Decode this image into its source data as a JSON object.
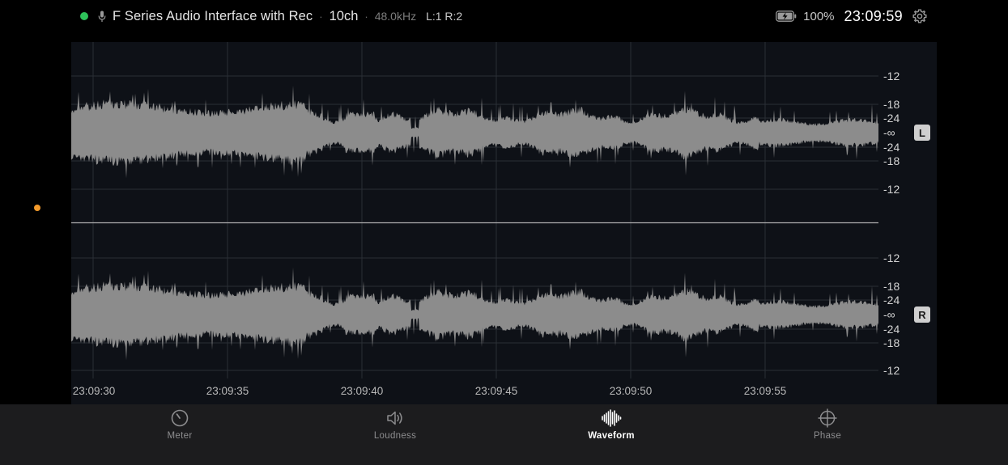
{
  "status_bar": {
    "connection_status_color": "#2ec25a",
    "device_name": "F Series Audio Interface with Rec",
    "separator": "·",
    "channels": "10ch",
    "sample_rate": "48.0kHz",
    "channel_map": "L:1 R:2",
    "battery_percent": "100%",
    "clock": "23:09:59",
    "icons": {
      "mic": "microphone-icon",
      "battery": "battery-charging-icon",
      "settings": "gear-icon"
    }
  },
  "waveform": {
    "channels": [
      {
        "badge": "L",
        "db_labels": [
          "-12",
          "-18",
          "-24",
          "-∞",
          "-24",
          "-18",
          "-12"
        ]
      },
      {
        "badge": "R",
        "db_labels": [
          "-12",
          "-18",
          "-24",
          "-∞",
          "-24",
          "-18",
          "-12"
        ]
      }
    ],
    "time_labels": [
      "23:09:30",
      "23:09:35",
      "23:09:40",
      "23:09:45",
      "23:09:50",
      "23:09:55"
    ],
    "colors": {
      "background": "#0e1117",
      "waveform": "#8c8c8c",
      "gridline": "#2a2e36",
      "center_line": "#b0b0b0"
    }
  },
  "tabs": [
    {
      "label": "Meter",
      "icon": "gauge-icon",
      "active": false
    },
    {
      "label": "Loudness",
      "icon": "speaker-icon",
      "active": false
    },
    {
      "label": "Waveform",
      "icon": "waveform-icon",
      "active": true
    },
    {
      "label": "Phase",
      "icon": "crosshair-icon",
      "active": false
    }
  ],
  "indicator": {
    "camera_dot_color": "#f39a2b"
  }
}
